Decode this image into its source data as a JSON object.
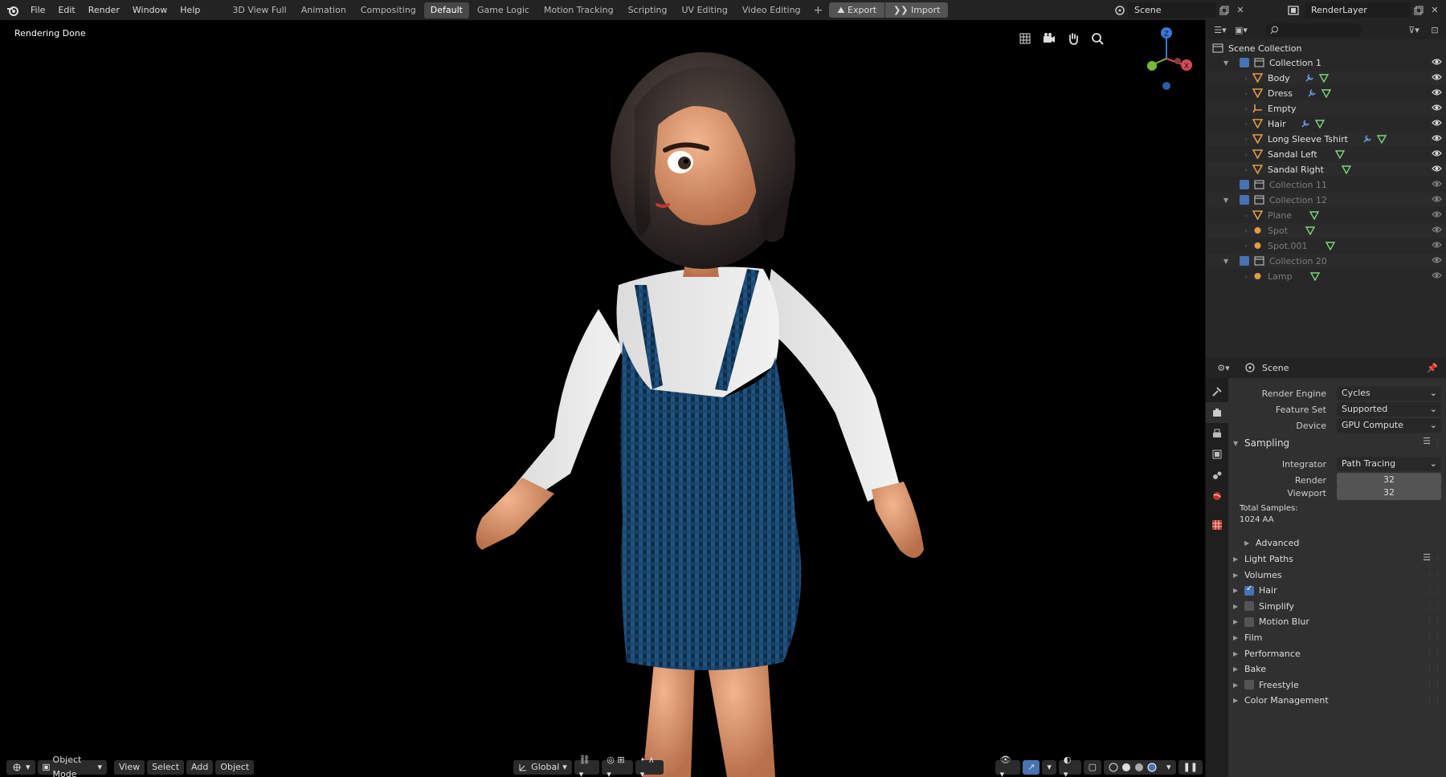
{
  "menu": [
    "File",
    "Edit",
    "Render",
    "Window",
    "Help"
  ],
  "workspaces": [
    "3D View Full",
    "Animation",
    "Compositing",
    "Default",
    "Game Logic",
    "Motion Tracking",
    "Scripting",
    "UV Editing",
    "Video Editing"
  ],
  "active_workspace": "Default",
  "topbar": {
    "export": "Export",
    "import": "Import",
    "scene": "Scene",
    "render_layer": "RenderLayer"
  },
  "viewport": {
    "status": "Rendering Done",
    "mode": "Object Mode",
    "menus": [
      "View",
      "Select",
      "Add",
      "Object"
    ],
    "orientation": "Global",
    "gizmo_axes": [
      "Z",
      "X"
    ]
  },
  "outliner": {
    "root": "Scene Collection",
    "rows": [
      {
        "name": "Collection 1",
        "type": "collection",
        "depth": 1,
        "checkbox": true,
        "dim": false,
        "expanded": true
      },
      {
        "name": "Body",
        "type": "mesh",
        "depth": 2,
        "modifier": true,
        "data": true,
        "dim": false
      },
      {
        "name": "Dress",
        "type": "mesh",
        "depth": 2,
        "modifier": true,
        "data": true,
        "dim": false
      },
      {
        "name": "Empty",
        "type": "empty",
        "depth": 2,
        "dim": false
      },
      {
        "name": "Hair",
        "type": "mesh",
        "depth": 2,
        "modifier": true,
        "data": true,
        "dim": false
      },
      {
        "name": "Long Sleeve Tshirt",
        "type": "mesh",
        "depth": 2,
        "modifier": true,
        "data": true,
        "dim": false
      },
      {
        "name": "Sandal Left",
        "type": "mesh",
        "depth": 2,
        "data": true,
        "dim": false
      },
      {
        "name": "Sandal Right",
        "type": "mesh",
        "depth": 2,
        "data": true,
        "dim": false
      },
      {
        "name": "Collection 11",
        "type": "collection",
        "depth": 1,
        "checkbox": true,
        "dim": true
      },
      {
        "name": "Collection 12",
        "type": "collection",
        "depth": 1,
        "checkbox": true,
        "dim": true,
        "expanded": true
      },
      {
        "name": "Plane",
        "type": "mesh",
        "depth": 2,
        "data": true,
        "dim": true
      },
      {
        "name": "Spot",
        "type": "light",
        "depth": 2,
        "data": true,
        "dim": true
      },
      {
        "name": "Spot.001",
        "type": "light",
        "depth": 2,
        "data": true,
        "dim": true
      },
      {
        "name": "Collection 20",
        "type": "collection",
        "depth": 1,
        "checkbox": true,
        "dim": true,
        "expanded": true
      },
      {
        "name": "Lamp",
        "type": "light",
        "depth": 2,
        "data": true,
        "dim": true
      }
    ]
  },
  "properties": {
    "context": "Scene",
    "render_engine": {
      "label": "Render Engine",
      "value": "Cycles"
    },
    "feature_set": {
      "label": "Feature Set",
      "value": "Supported"
    },
    "device": {
      "label": "Device",
      "value": "GPU Compute"
    },
    "sampling": {
      "title": "Sampling",
      "integrator": {
        "label": "Integrator",
        "value": "Path Tracing"
      },
      "render": {
        "label": "Render",
        "value": "32"
      },
      "viewport": {
        "label": "Viewport",
        "value": "32"
      },
      "total_label": "Total Samples:",
      "total_value": "1024 AA",
      "advanced": "Advanced"
    },
    "panels": [
      {
        "title": "Light Paths",
        "checkbox": null,
        "list_icon": true
      },
      {
        "title": "Volumes",
        "checkbox": null
      },
      {
        "title": "Hair",
        "checkbox": true
      },
      {
        "title": "Simplify",
        "checkbox": false
      },
      {
        "title": "Motion Blur",
        "checkbox": false
      },
      {
        "title": "Film",
        "checkbox": null
      },
      {
        "title": "Performance",
        "checkbox": null
      },
      {
        "title": "Bake",
        "checkbox": null
      },
      {
        "title": "Freestyle",
        "checkbox": false
      },
      {
        "title": "Color Management",
        "checkbox": null
      }
    ]
  },
  "colors": {
    "accent": "#4772b3",
    "mesh_icon": "#e09a4c",
    "modifier_icon": "#6e9ee6",
    "data_icon": "#7bd67b"
  }
}
